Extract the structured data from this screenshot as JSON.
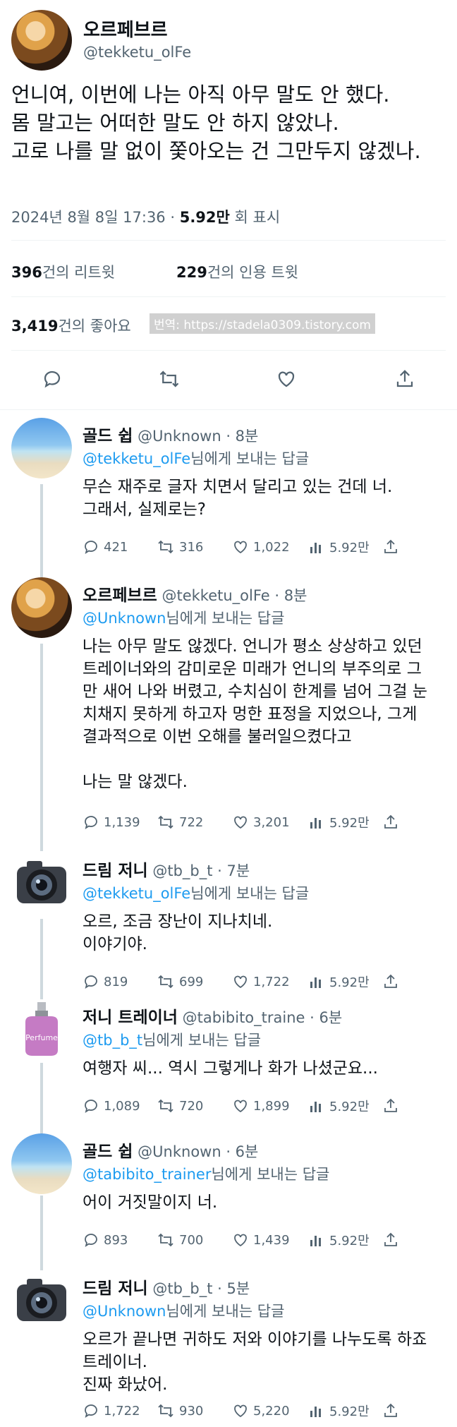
{
  "main": {
    "name": "오르페브르",
    "handle": "@tekketu_olFe",
    "text": "언니여, 이번에 나는 아직 아무 말도 안 했다.\n몸 말고는 어떠한 말도 안 하지 않았나.\n고로 나를 말 없이 쫓아오는 건 그만두지 않겠나.",
    "date": "2024년 8월 8일 17:36 · ",
    "views_value": "5.92만",
    "views_suffix": " 회 표시",
    "retweets_count": "396",
    "retweets_label": "건의 리트윗",
    "quotes_count": "229",
    "quotes_label": "건의 인용 트윗",
    "likes_count": "3,419",
    "likes_label": "건의 좋아요",
    "watermark": "번역: https://stadela0309.tistory.com"
  },
  "replies": [
    {
      "name": "골드 쉽",
      "sub": " @Unknown · 8분",
      "mention": "@tekketu_olFe",
      "to_suffix": "님에게 보내는 답글",
      "text": "무슨 재주로 글자 치면서 달리고 있는 건데 너.\n그래서, 실제로는?",
      "replies": "421",
      "retweets": "316",
      "likes": "1,022",
      "views": "5.92만"
    },
    {
      "name": "오르페브르",
      "sub": " @tekketu_olFe · 8분",
      "mention": "@Unknown",
      "to_suffix": "님에게 보내는 답글",
      "text": "나는 아무 말도 않겠다. 언니가 평소 상상하고 있던 트레이너와의 감미로운 미래가 언니의 부주의로 그만 새어 나와 버렸고, 수치심이 한계를 넘어 그걸 눈치채지 못하게 하고자 멍한 표정을 지었으나, 그게 결과적으로 이번 오해를 불러일으켰다고\n\n나는 말 않겠다.",
      "replies": "1,139",
      "retweets": "722",
      "likes": "3,201",
      "views": "5.92만"
    },
    {
      "name": "드림 저니",
      "sub": " @tb_b_t · 7분",
      "mention": "@tekketu_olFe",
      "to_suffix": "님에게 보내는 답글",
      "text": "오르, 조금 장난이 지나치네.\n이야기야.",
      "replies": "819",
      "retweets": "699",
      "likes": "1,722",
      "views": "5.92만"
    },
    {
      "name": "저니 트레이너",
      "sub": " @tabibito_traine · 6분",
      "mention": "@tb_b_t",
      "to_suffix": "님에게 보내는 답글",
      "text": "여행자 씨... 역시 그렇게나 화가 나셨군요...",
      "replies": "1,089",
      "retweets": "720",
      "likes": "1,899",
      "views": "5.92만",
      "avatar_label": "Perfume"
    },
    {
      "name": "골드 쉽",
      "sub": " @Unknown · 6분",
      "mention": "@tabibito_trainer",
      "to_suffix": "님에게 보내는 답글",
      "text": "어이 거짓말이지 너.",
      "replies": "893",
      "retweets": "700",
      "likes": "1,439",
      "views": "5.92만"
    },
    {
      "name": "드림 저니",
      "sub": " @tb_b_t · 5분",
      "mention": "@Unknown",
      "to_suffix": "님에게 보내는 답글",
      "text": "오르가 끝나면 귀하도 저와 이야기를 나누도록 하죠 트레이너.\n진짜 화났어.",
      "replies": "1,722",
      "retweets": "930",
      "likes": "5,220",
      "views": "5.92만"
    }
  ],
  "colors": {
    "link": "#1d9bf0",
    "muted": "#536471",
    "text": "#0f1419",
    "line": "#cfd9de"
  },
  "icons": [
    "reply-icon",
    "retweet-icon",
    "like-icon",
    "share-icon",
    "views-icon"
  ]
}
